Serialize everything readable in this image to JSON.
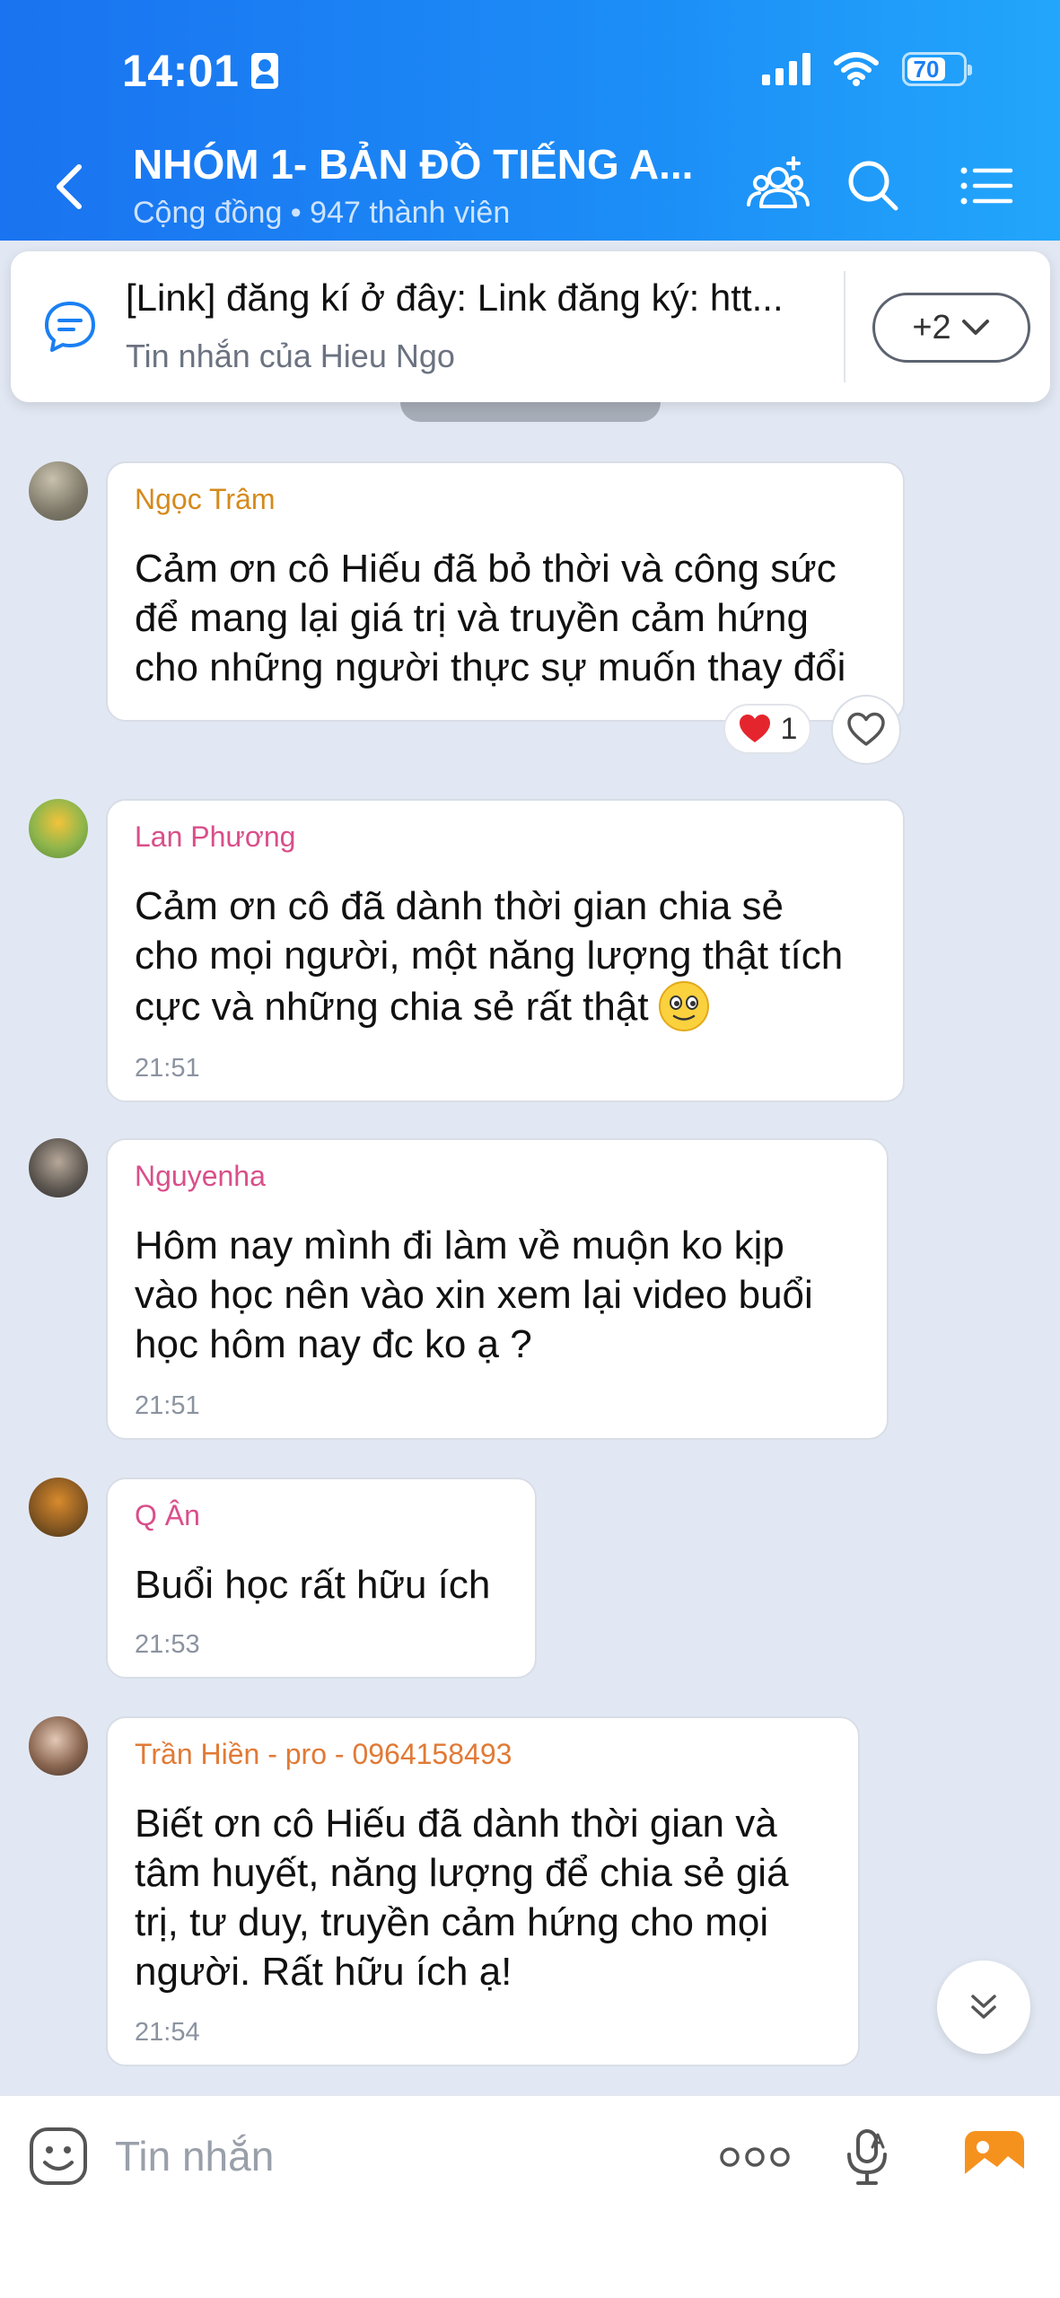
{
  "status_bar": {
    "time": "14:01",
    "battery": "70"
  },
  "header": {
    "title": "NHÓM 1- BẢN ĐỒ TIẾNG A...",
    "subtitle": "Cộng đồng • 947 thành viên"
  },
  "pinned": {
    "text": "[Link] đăng kí ở đây: Link đăng ký: htt...",
    "from": "Tin nhắn của Hieu Ngo",
    "more": "+2"
  },
  "messages": [
    {
      "sender": "Ngọc Trâm",
      "sender_color": "#d58a1c",
      "lines": [
        "Cảm ơn cô Hiếu đã bỏ thời và công sức",
        "để mang lại giá trị và truyền cảm hứng",
        "cho những người thực sự muốn thay đổi"
      ],
      "time": "",
      "reaction_count": "1"
    },
    {
      "sender": "Lan Phương",
      "sender_color": "#d94f8a",
      "lines": [
        "Cảm ơn cô đã dành thời gian chia sẻ",
        "cho mọi người, một năng lượng thật tích",
        "cực và những chia sẻ rất thật"
      ],
      "time": "21:51"
    },
    {
      "sender": "Nguyenha",
      "sender_color": "#d94f8a",
      "lines": [
        "Hôm nay mình đi làm về muộn ko kịp",
        "vào học nên vào xin xem lại video buổi",
        "học hôm nay đc ko ạ ?"
      ],
      "time": "21:51"
    },
    {
      "sender": "Q Ân",
      "sender_color": "#d94f8a",
      "lines": [
        "Buổi học rất hữu ích"
      ],
      "time": "21:53"
    },
    {
      "sender": "Trần Hiền - pro - 0964158493",
      "sender_color": "#e07a36",
      "lines": [
        "Biết ơn cô Hiếu đã dành thời gian và",
        "tâm huyết, năng lượng để chia sẻ giá",
        "trị, tư duy, truyền cảm hứng cho mọi",
        "người. Rất hữu ích ạ!"
      ],
      "time": "21:54"
    }
  ],
  "input": {
    "placeholder": "Tin nhắn"
  },
  "colors": {
    "header_blue": "#1a7ff3",
    "accent_orange": "#f5921e"
  }
}
